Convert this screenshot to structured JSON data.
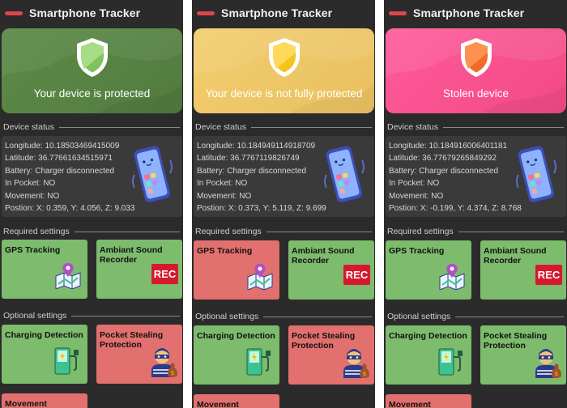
{
  "app": {
    "title": "Smartphone Tracker"
  },
  "screens": [
    {
      "hero": {
        "text": "Your device is protected",
        "color": "#5d8a48",
        "shield_color": "#7fc35b"
      },
      "device_status": {
        "label": "Device status",
        "lines": [
          "Longitude: 10.18503469415009",
          "Latitude: 36.77661634515971",
          "Battery: Charger disconnected",
          "In Pocket: NO",
          "Movement: NO",
          "Postion: X: 0.359, Y: 4.056, Z: 9.033"
        ]
      },
      "required": {
        "label": "Required settings",
        "gps": {
          "label": "GPS Tracking",
          "state": "green"
        },
        "sound": {
          "label": "Ambiant Sound Recorder",
          "badge": "REC",
          "state": "green"
        }
      },
      "optional": {
        "label": "Optional settings",
        "charging": {
          "label": "Charging Detection",
          "state": "green"
        },
        "pocket": {
          "label": "Pocket Stealing Protection",
          "state": "red"
        },
        "movement": {
          "label": "Movement Detection",
          "state": "red"
        }
      }
    },
    {
      "hero": {
        "text": "Your device is not fully protected",
        "color": "#f2cd6e",
        "shield_color": "#f6c21c"
      },
      "device_status": {
        "label": "Device status",
        "lines": [
          "Longitude: 10.184949114918709",
          "Latitude: 36.7767119826749",
          "Battery: Charger disconnected",
          "In Pocket: NO",
          "Movement: NO",
          "Postion: X: 0.373, Y: 5.119, Z: 9.699"
        ]
      },
      "required": {
        "label": "Required settings",
        "gps": {
          "label": "GPS Tracking",
          "state": "red"
        },
        "sound": {
          "label": "Ambiant Sound Recorder",
          "badge": "REC",
          "state": "green"
        }
      },
      "optional": {
        "label": "Optional settings",
        "charging": {
          "label": "Charging Detection",
          "state": "green"
        },
        "pocket": {
          "label": "Pocket Stealing Protection",
          "state": "red"
        },
        "movement": {
          "label": "Movement Detection",
          "state": "red"
        }
      }
    },
    {
      "hero": {
        "text": "Stolen device",
        "color": "#ff5a9a",
        "shield_color": "#f36b2b"
      },
      "device_status": {
        "label": "Device status",
        "lines": [
          "Longitude: 10.184916006401181",
          "Latitude: 36.77679265849292",
          "Battery: Charger disconnected",
          "In Pocket: NO",
          "Movement: NO",
          "Postion: X: -0.199, Y: 4.374, Z: 8.768"
        ]
      },
      "required": {
        "label": "Required settings",
        "gps": {
          "label": "GPS Tracking",
          "state": "green"
        },
        "sound": {
          "label": "Ambiant Sound Recorder",
          "badge": "REC",
          "state": "green"
        }
      },
      "optional": {
        "label": "Optional settings",
        "charging": {
          "label": "Charging Detection",
          "state": "green"
        },
        "pocket": {
          "label": "Pocket Stealing Protection",
          "state": "green"
        },
        "movement": {
          "label": "Movement Detection",
          "state": "red"
        }
      }
    }
  ]
}
